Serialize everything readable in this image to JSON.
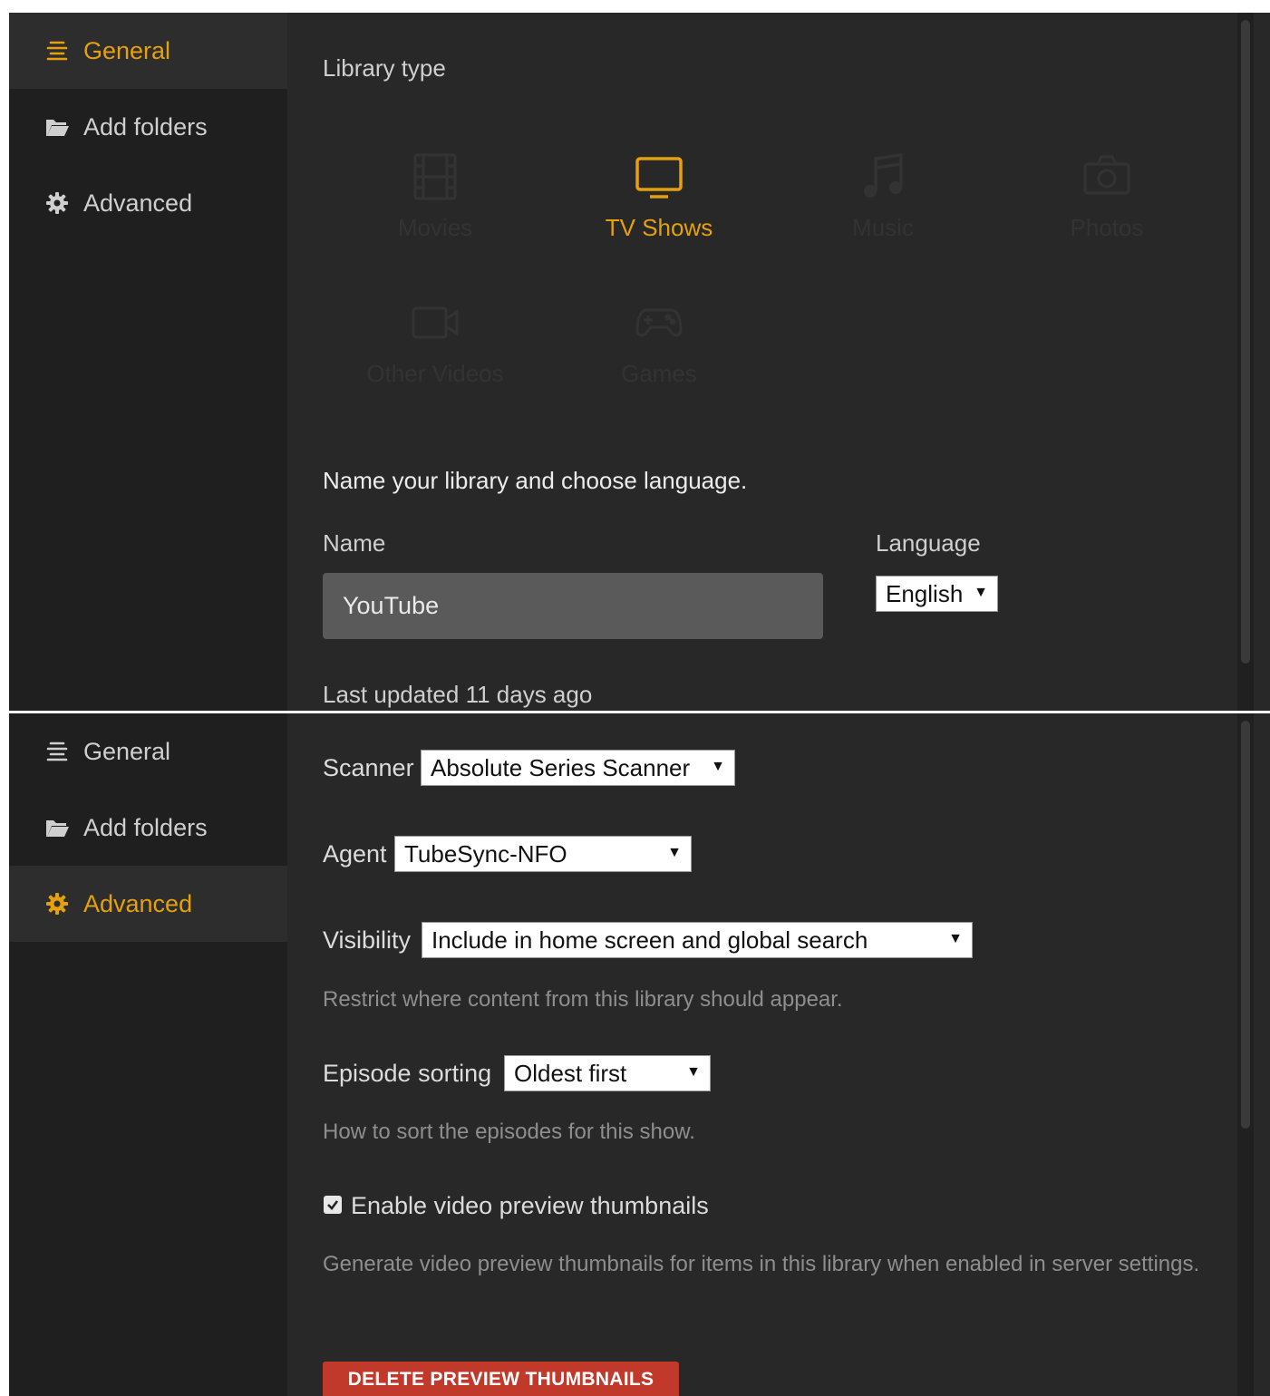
{
  "top_panel": {
    "sidebar": {
      "items": [
        {
          "label": "General",
          "icon": "general-lines-icon",
          "active": true
        },
        {
          "label": "Add folders",
          "icon": "folder-open-icon",
          "active": false
        },
        {
          "label": "Advanced",
          "icon": "gear-icon",
          "active": false
        }
      ]
    },
    "library_type_label": "Library type",
    "library_types": [
      {
        "label": "Movies",
        "icon": "film-icon",
        "selected": false
      },
      {
        "label": "TV Shows",
        "icon": "tv-icon",
        "selected": true
      },
      {
        "label": "Music",
        "icon": "music-note-icon",
        "selected": false
      },
      {
        "label": "Photos",
        "icon": "camera-icon",
        "selected": false
      },
      {
        "label": "Other Videos",
        "icon": "video-camera-icon",
        "selected": false
      },
      {
        "label": "Games",
        "icon": "gamepad-icon",
        "selected": false
      }
    ],
    "name_heading": "Name your library and choose language.",
    "name_label": "Name",
    "name_value": "YouTube",
    "language_label": "Language",
    "language_value": "English",
    "last_updated": "Last updated 11 days ago"
  },
  "bottom_panel": {
    "sidebar": {
      "items": [
        {
          "label": "General",
          "icon": "general-lines-icon",
          "active": false
        },
        {
          "label": "Add folders",
          "icon": "folder-open-icon",
          "active": false
        },
        {
          "label": "Advanced",
          "icon": "gear-icon",
          "active": true
        }
      ]
    },
    "scanner_label": "Scanner",
    "scanner_value": "Absolute Series Scanner",
    "agent_label": "Agent",
    "agent_value": "TubeSync-NFO",
    "visibility_label": "Visibility",
    "visibility_value": "Include in home screen and global search",
    "visibility_help": "Restrict where content from this library should appear.",
    "episode_sorting_label": "Episode sorting",
    "episode_sorting_value": "Oldest first",
    "episode_sorting_help": "How to sort the episodes for this show.",
    "preview_thumbnails_label": "Enable video preview thumbnails",
    "preview_thumbnails_checked": true,
    "preview_thumbnails_help": "Generate video preview thumbnails for items in this library when enabled in server settings.",
    "delete_button_label": "DELETE PREVIEW THUMBNAILS"
  },
  "colors": {
    "accent": "#e5a00d",
    "panel_bg": "#282828",
    "sidebar_bg": "#1f1f1f",
    "danger": "#c0392b"
  },
  "caret": "▼"
}
